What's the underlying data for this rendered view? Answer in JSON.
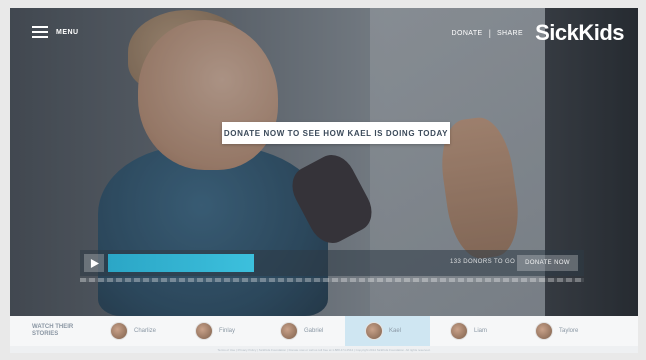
{
  "header": {
    "menu_label": "MENU",
    "donate_label": "DONATE",
    "share_label": "SHARE",
    "separator": "|",
    "logo_text": "SickKids"
  },
  "hero": {
    "cta_text": "DONATE NOW TO SEE HOW KAEL IS DOING TODAY",
    "progress_fraction": 0.31,
    "donors_text": "133 DONORS TO GO",
    "donate_button": "DONATE NOW"
  },
  "stories": {
    "label_line1": "WATCH THEIR",
    "label_line2": "STORIES",
    "items": [
      {
        "name": "Charlize"
      },
      {
        "name": "Finlay"
      },
      {
        "name": "Gabriel"
      },
      {
        "name": "Kael"
      },
      {
        "name": "Liam"
      },
      {
        "name": "Taylore"
      }
    ],
    "active_index": 3
  },
  "footer": {
    "text": "Terms of Use | Privacy Policy | SickKids Foundation | Donate now or call us toll free at 1.888.474.2544 | Copyright 2014 SickKids Foundation. All rights reserved."
  },
  "colors": {
    "accent": "#2ba6c6",
    "active_story_bg": "#cfe6f2"
  }
}
